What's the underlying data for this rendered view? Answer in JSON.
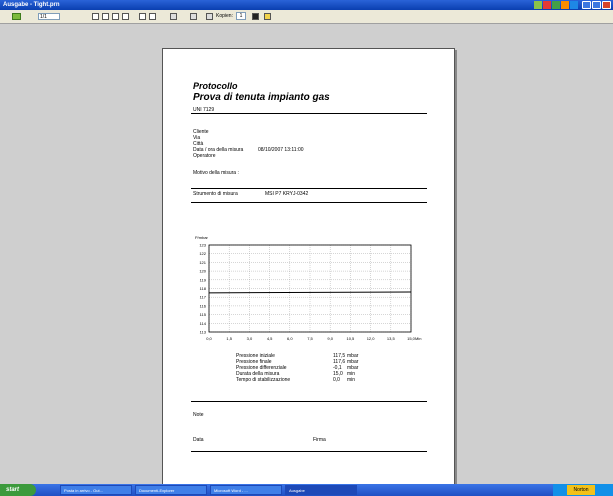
{
  "window": {
    "title": "Ausgabe - Tight.prn"
  },
  "toolbar": {
    "page_value": "1/1",
    "copies_label": "Kopien:",
    "copies_value": "1"
  },
  "document": {
    "title_1": "Protocollo",
    "title_2": "Prova di tenuta impianto gas",
    "standard": "UNI 7129",
    "fields": [
      "Cliente",
      "Via",
      "Città",
      "Data / ora della misura",
      "Operatore"
    ],
    "datetime_value": "08/10/2007 13:11:00",
    "reason_label": "Motivo della misura :",
    "instrument_label": "Strumento di misura",
    "instrument_value": "MSI P7    KRYJ-0342",
    "results": [
      {
        "label": "Pressione iniziale",
        "value": "117,5",
        "unit": "mbar"
      },
      {
        "label": "Pressione finale",
        "value": "117,6",
        "unit": "mbar"
      },
      {
        "label": "Pressione differenziale",
        "value": "-0,1",
        "unit": "mbar"
      },
      {
        "label": "Durata della misura",
        "value": "15,0",
        "unit": "min"
      },
      {
        "label": "Tempo di stabilizzazione",
        "value": "0,0",
        "unit": "min"
      }
    ],
    "note_label": "Note",
    "date_label": "Data",
    "signature_label": "Firma"
  },
  "chart_data": {
    "type": "line",
    "ylabel": "P/mbar",
    "xlabel": "Min",
    "xlim": [
      0,
      15
    ],
    "ylim": [
      113,
      123
    ],
    "x_ticks": [
      "0,0",
      "1,5",
      "3,0",
      "4,5",
      "6,0",
      "7,5",
      "9,0",
      "10,5",
      "12,0",
      "13,5",
      "15,0"
    ],
    "y_ticks": [
      "113",
      "114",
      "115",
      "116",
      "117",
      "118",
      "119",
      "120",
      "121",
      "122",
      "123"
    ],
    "grid": true,
    "series": [
      {
        "x": [
          0,
          15
        ],
        "y": [
          117.5,
          117.6
        ]
      }
    ]
  },
  "taskbar": {
    "start_label": "start",
    "tasks": [
      "Posta in arrivo - Out...",
      "Documenti-Explorer",
      "Microsoft Word - ...",
      "Ausgabe"
    ],
    "highlight_label": "Norton"
  }
}
